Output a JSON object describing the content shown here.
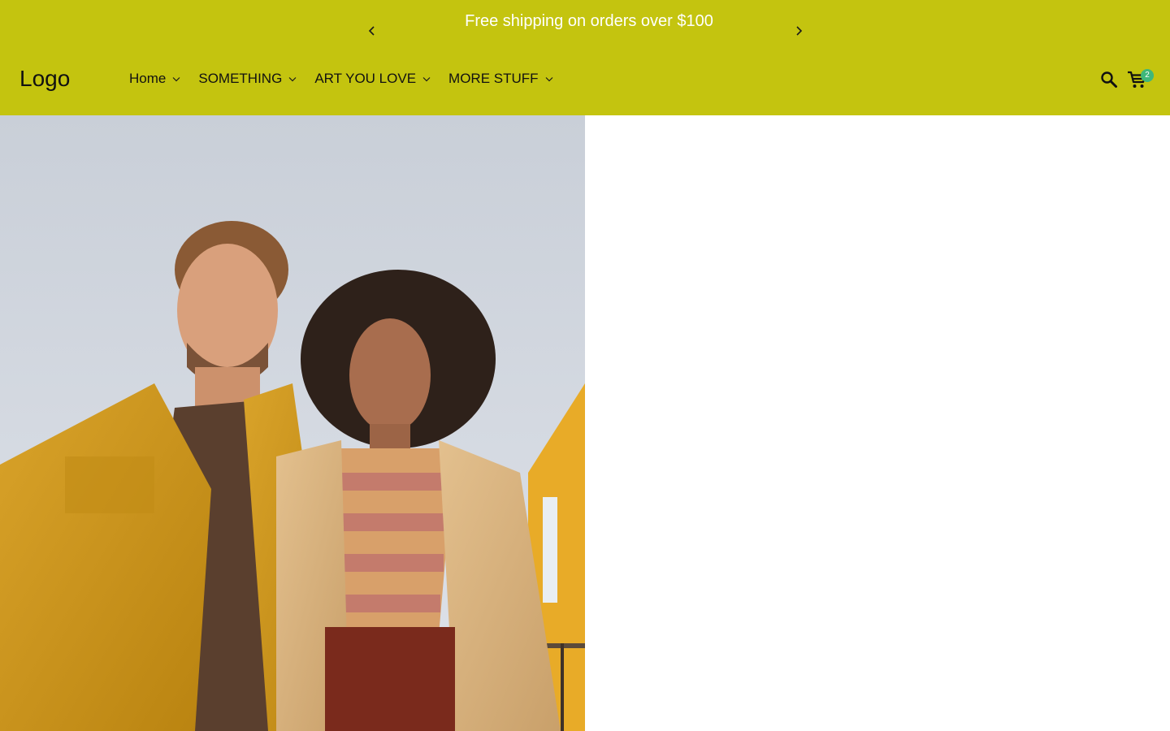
{
  "announcement": {
    "text": "Free shipping on orders over $100"
  },
  "header": {
    "logo": "Logo",
    "nav": [
      {
        "label": "Home"
      },
      {
        "label": "SOMETHING"
      },
      {
        "label": "ART YOU LOVE"
      },
      {
        "label": "MORE STUFF"
      }
    ],
    "cart_count": "2"
  },
  "colors": {
    "header_bg": "#c4c40f",
    "badge_bg": "#3fb77a"
  },
  "icons": [
    "chevron-left-icon",
    "chevron-right-icon",
    "chevron-down-icon",
    "search-icon",
    "cart-icon"
  ]
}
